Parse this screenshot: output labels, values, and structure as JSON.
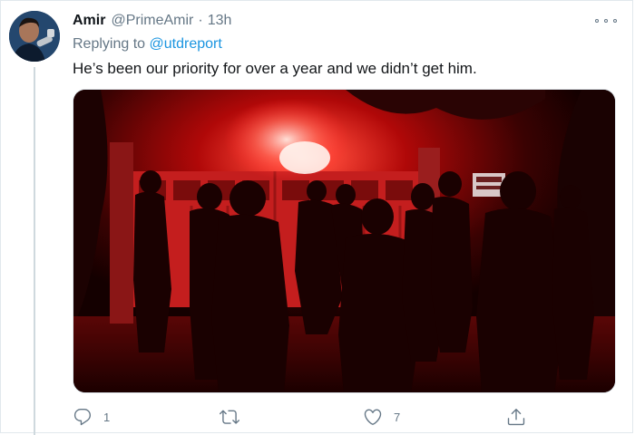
{
  "tweet": {
    "display_name": "Amir",
    "handle": "@PrimeAmir",
    "separator": "·",
    "time": "13h",
    "replying_prefix": "Replying to",
    "replying_to": "@utdreport",
    "text": "He’s been our priority for over a year and we didn’t get him.",
    "media_alt": "Night photo of silhouetted people in front of a gate lit by a red flare",
    "sign_text": "TR"
  },
  "actions": {
    "reply_count": "1",
    "retweet_count": "",
    "like_count": "7"
  },
  "icons": {
    "more": "more-horizontal-icon",
    "reply": "reply-icon",
    "retweet": "retweet-icon",
    "like": "heart-icon",
    "share": "share-icon"
  },
  "colors": {
    "link": "#1b95e0",
    "muted": "#657786",
    "text": "#0f1419",
    "flare_red": "#e01010"
  }
}
